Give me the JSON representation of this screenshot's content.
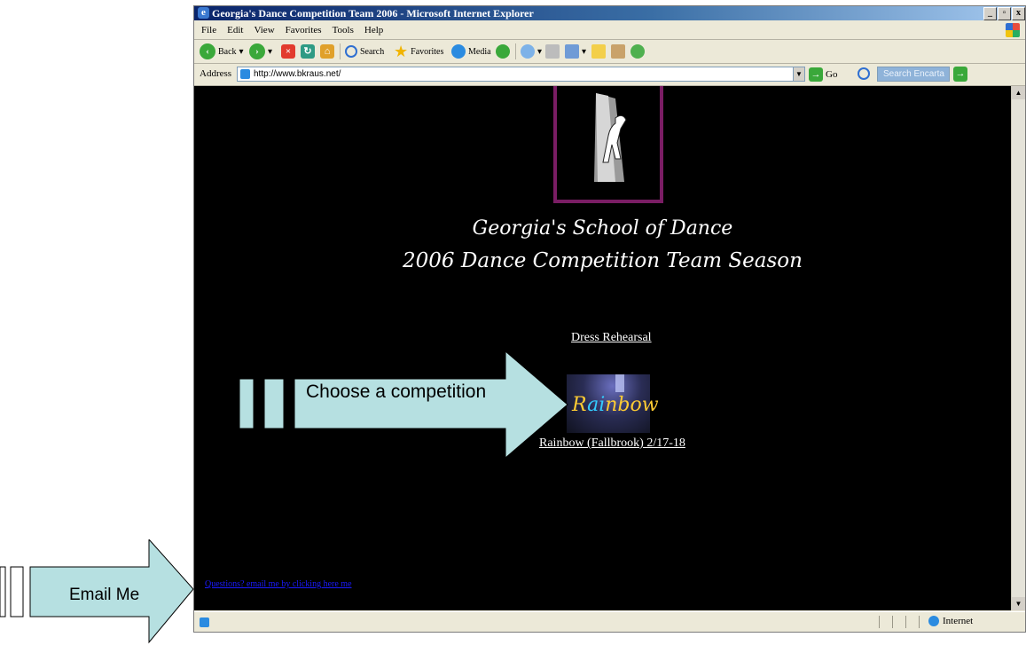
{
  "window": {
    "title": "Georgia's Dance Competition Team 2006 - Microsoft Internet Explorer",
    "controls": [
      "_",
      "▫",
      "x"
    ]
  },
  "menu": {
    "items": [
      "File",
      "Edit",
      "View",
      "Favorites",
      "Tools",
      "Help"
    ]
  },
  "toolbar": {
    "back_label": "Back",
    "search_label": "Search",
    "favorites_label": "Favorites",
    "media_label": "Media"
  },
  "address": {
    "label": "Address",
    "url": "http://www.bkraus.net/",
    "go_label": "Go",
    "encarta_placeholder": "Search Encarta"
  },
  "page": {
    "title_line1": "Georgia's School of Dance",
    "title_line2": "2006 Dance Competition Team Season",
    "dress_link": "Dress Rehearsal",
    "rainbow_link": "Rainbow (Fallbrook) 2/17-18",
    "email_link": "Questions? email me by clicking here me"
  },
  "status": {
    "zone": "Internet"
  },
  "annotations": {
    "choose_competition": "Choose a competition",
    "email_me": "Email Me"
  }
}
